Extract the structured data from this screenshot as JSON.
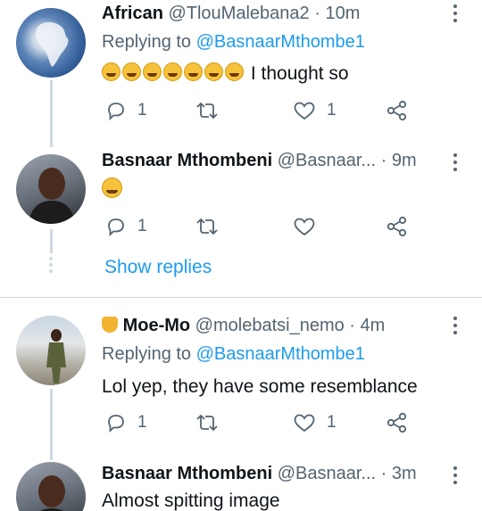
{
  "tweets": [
    {
      "name": "African",
      "handle": "@TlouMalebana2",
      "dot": "·",
      "time": "10m",
      "replying_prefix": "Replying to",
      "replying_to": "@BasnaarMthombe1",
      "text": "I thought so",
      "emoji_count": 7,
      "emoji_name": "rolling-on-floor-laughing-emoji",
      "replies": "1",
      "retweets": "",
      "likes": "1"
    },
    {
      "name": "Basnaar Mthombeni",
      "handle": "@Basnaar...",
      "dot": "·",
      "time": "9m",
      "emoji_name": "grinning-squinting-emoji",
      "replies": "1",
      "retweets": "",
      "likes": ""
    },
    {
      "name": "Moe-Mo",
      "name_emoji": "backhand-index-pointing-down-emoji",
      "handle": "@molebatsi_nemo",
      "dot": "·",
      "time": "4m",
      "replying_prefix": "Replying to",
      "replying_to": "@BasnaarMthombe1",
      "text": "Lol yep, they have some resemblance",
      "replies": "1",
      "retweets": "",
      "likes": "1"
    },
    {
      "name": "Basnaar Mthombeni",
      "handle": "@Basnaar...",
      "dot": "·",
      "time": "3m",
      "text": "Almost spitting image"
    }
  ],
  "show_replies": "Show replies",
  "colors": {
    "link": "#1d9bf0",
    "muted": "#536471",
    "text": "#0f1419",
    "line": "#cfd9de"
  }
}
